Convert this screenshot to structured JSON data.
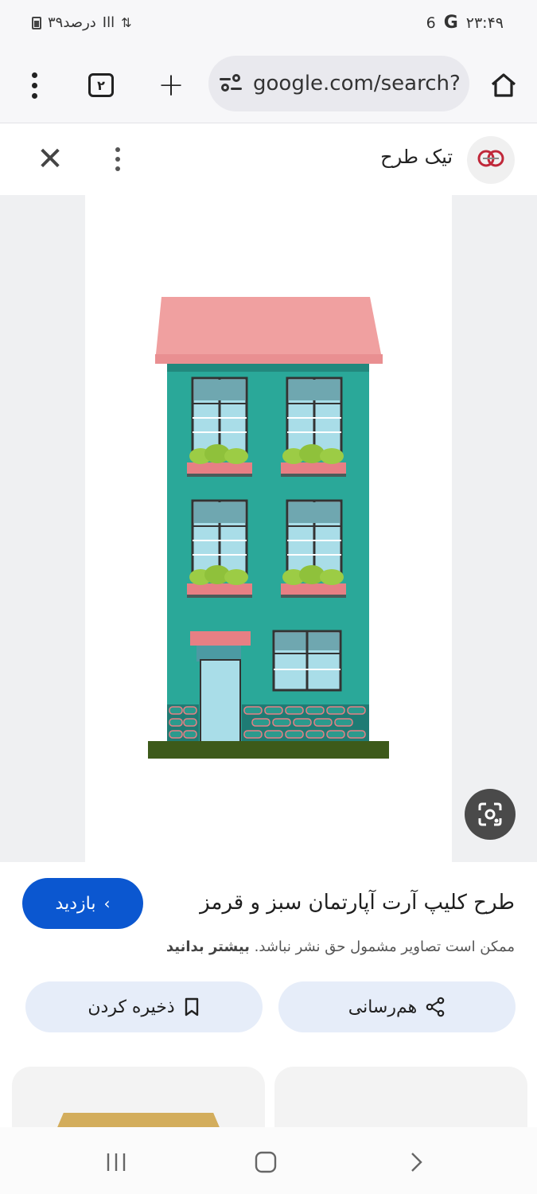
{
  "status_bar": {
    "battery_text": "۳۹درصد",
    "signal_label": "Ill",
    "time": "۲۳:۴۹",
    "network_digit": "6",
    "g_label": "G"
  },
  "toolbar": {
    "tab_count": "۲",
    "new_tab_label": "+",
    "url": "google.com/search?"
  },
  "viewer": {
    "site_name": "تیک طرح",
    "close_label": "✕"
  },
  "info": {
    "title": "طرح کلیپ آرت آپارتمان سبز و قرمز",
    "visit_label": "بازدید",
    "notice_text": "ممکن است تصاویر مشمول حق نشر نباشد.",
    "learn_more": "بیشتر بدانید",
    "share_label": "هم‌رسانی",
    "save_label": "ذخیره کردن"
  },
  "colors": {
    "accent": "#0b57d0",
    "pill_bg": "#e6edf9",
    "building_wall": "#2aa899",
    "roof": "#f0a0a0",
    "window": "#a9dde8"
  }
}
